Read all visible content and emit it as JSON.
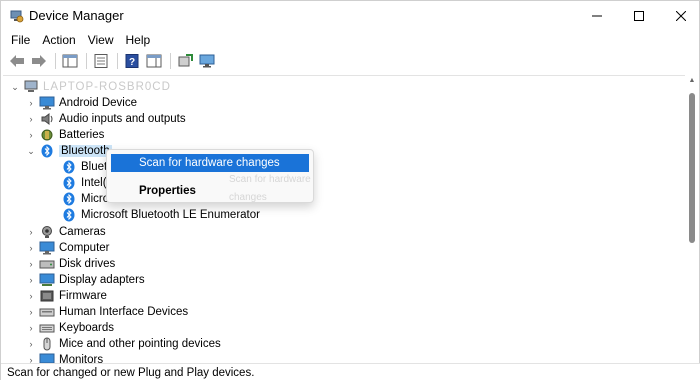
{
  "window": {
    "title": "Device Manager",
    "controls": {
      "minimize": "—",
      "maximize": "☐",
      "close": "✕"
    }
  },
  "menubar": {
    "items": [
      "File",
      "Action",
      "View",
      "Help"
    ]
  },
  "toolbar": {
    "icons": [
      "back-arrow-icon",
      "forward-arrow-icon",
      "show-hide-console-tree-icon",
      "properties-icon",
      "help-icon",
      "action-pane-icon",
      "update-driver-icon",
      "scan-hardware-icon"
    ]
  },
  "tree": {
    "root_label": "LAPTOP-ROSBR0CD",
    "items": [
      {
        "label": "Android Device",
        "expanded": false,
        "icon": "monitor-icon"
      },
      {
        "label": "Audio inputs and outputs",
        "expanded": false,
        "icon": "speaker-icon"
      },
      {
        "label": "Batteries",
        "expanded": false,
        "icon": "battery-icon"
      },
      {
        "label": "Bluetooth",
        "expanded": true,
        "icon": "bluetooth-icon",
        "selected": true,
        "children": [
          {
            "label": "Bluetooth Device (Personal Area Network)",
            "visible_label": "Blueto"
          },
          {
            "label": "Intel(R) Wireless Bluetooth(R)",
            "visible_label": "Intel(R"
          },
          {
            "label": "Microsoft Bluetooth Enumerator",
            "visible_label": "Microsoft Bluetooth Enumerator"
          },
          {
            "label": "Microsoft Bluetooth LE Enumerator",
            "visible_label": "Microsoft Bluetooth LE Enumerator"
          }
        ]
      },
      {
        "label": "Cameras",
        "expanded": false,
        "icon": "camera-icon"
      },
      {
        "label": "Computer",
        "expanded": false,
        "icon": "computer-icon"
      },
      {
        "label": "Disk drives",
        "expanded": false,
        "icon": "disk-drive-icon"
      },
      {
        "label": "Display adapters",
        "expanded": false,
        "icon": "display-adapter-icon"
      },
      {
        "label": "Firmware",
        "expanded": false,
        "icon": "firmware-icon"
      },
      {
        "label": "Human Interface Devices",
        "expanded": false,
        "icon": "hid-icon"
      },
      {
        "label": "Keyboards",
        "expanded": false,
        "icon": "keyboard-icon"
      },
      {
        "label": "Mice and other pointing devices",
        "expanded": false,
        "icon": "mouse-icon"
      },
      {
        "label": "Monitors",
        "expanded": false,
        "icon": "monitor-icon"
      }
    ]
  },
  "context_menu": {
    "scan_label": "Scan for hardware changes",
    "faint_label": "Scan for hardware changes",
    "properties_label": "Properties"
  },
  "statusbar": {
    "text": "Scan for changed or new Plug and Play devices."
  },
  "colors": {
    "highlight": "#1a73d8",
    "selection": "#cce4f7",
    "bluetooth": "#1e7be0"
  }
}
